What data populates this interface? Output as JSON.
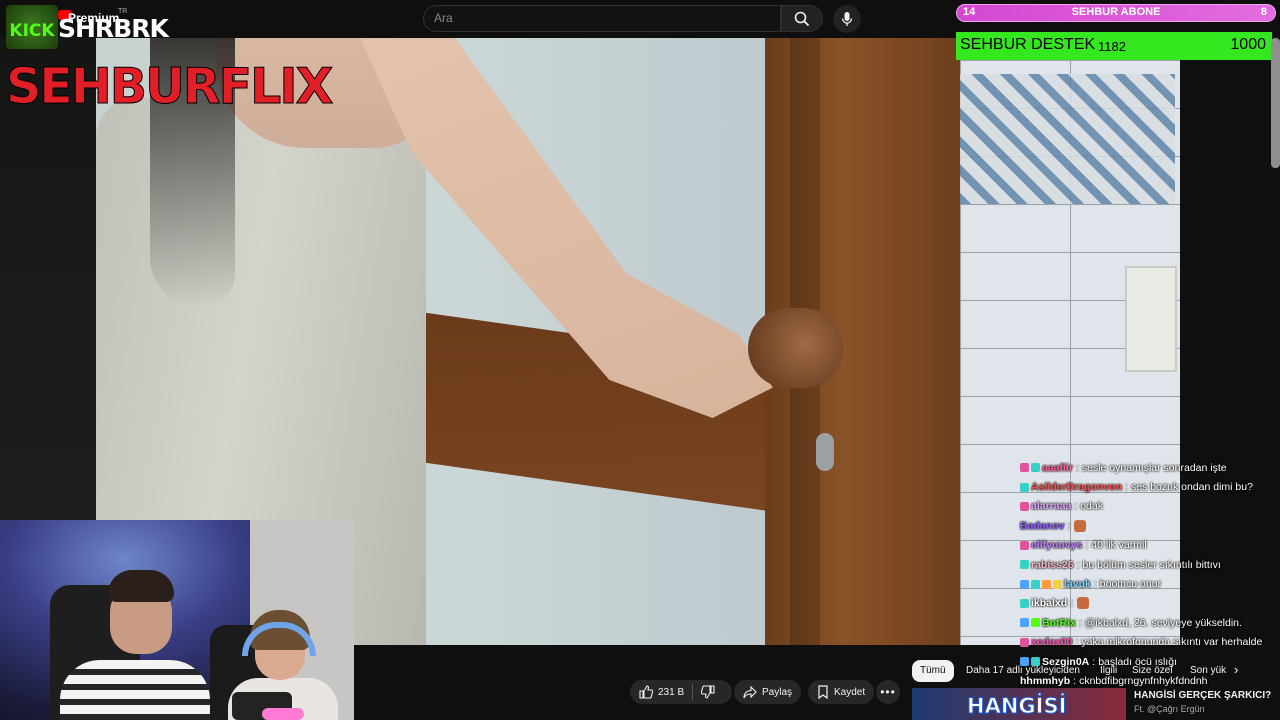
{
  "search": {
    "placeholder": "Ara"
  },
  "brand": {
    "youtube_premium": "Premium",
    "youtube_region": "TR",
    "kick": "KICK",
    "channel": "SHRBRK",
    "overlay_title": "SEHBURFLIX"
  },
  "goals": {
    "abone": {
      "label": "SEHBUR ABONE",
      "left": "14",
      "right": "8"
    },
    "destek": {
      "label": "SEHBUR DESTEK",
      "current": "1182",
      "target": "1000"
    }
  },
  "chat": [
    {
      "user": "aaafiir",
      "user_color": "#ff5f9e",
      "message": "sesle oynamışlar sonradan işte",
      "badges": [
        "#e0529c",
        "#35d0c6"
      ]
    },
    {
      "user": "AsilderDragonvon",
      "user_color": "#ff4f4f",
      "message": "ses bozuk ondan dimi bu?",
      "badges": [
        "#35d0c6"
      ]
    },
    {
      "user": "alarraaa",
      "user_color": "#e0a8ff",
      "message": "odak",
      "badges": [
        "#e0529c"
      ]
    },
    {
      "user": "Badanov",
      "user_color": "#8e5cff",
      "message": "",
      "badges": [],
      "emote": true
    },
    {
      "user": "elifyuuvys",
      "user_color": "#c27bff",
      "message": "40 lik varmil",
      "badges": [
        "#e0529c"
      ]
    },
    {
      "user": "rabiss26",
      "user_color": "#f0b8c8",
      "message": "bu bölüm sesler sıkıntılı bittıvı",
      "badges": [
        "#35d0c6"
      ]
    },
    {
      "user": "lavuk",
      "user_color": "#7fd3ff",
      "message": "boomcu onur",
      "badges": [
        "#4aa3ff",
        "#35d0c6",
        "#ff9a3d",
        "#f5d142"
      ]
    },
    {
      "user": "ikbalxd",
      "user_color": "#ffffff",
      "message": "",
      "badges": [
        "#35d0c6"
      ],
      "emote": true
    },
    {
      "user": "BotRix",
      "user_color": "#53fc18",
      "message": "@ikbalxd, 26. seviyeye yükseldin.",
      "badges": [
        "#4aa3ff",
        "#53fc18"
      ]
    },
    {
      "user": "xedax00",
      "user_color": "#ff4fb1",
      "message": "yaka mikrofonunda sıkıntı var herhalde",
      "badges": [
        "#e0529c"
      ]
    },
    {
      "user": "Sezgin0A",
      "user_color": "#ffffff",
      "message": "başladı öcü ıslığı",
      "badges": [
        "#4aa3ff",
        "#35d0c6"
      ]
    },
    {
      "user": "hhmmhyb",
      "user_color": "#ffffff",
      "message": "cknbdfibgrngynfnhykfdndnh",
      "badges": []
    }
  ],
  "actions": {
    "likes": "231 B",
    "share": "Paylaş",
    "save": "Kaydet"
  },
  "chips": [
    "Tümü",
    "Daha 17 adlı yükleyiciden",
    "İlgili",
    "Size özel",
    "Son yük"
  ],
  "suggestion": {
    "thumb_text": "HANGİSİ",
    "title": "HANGİSİ GERÇEK ŞARKICI?",
    "channel": "Ft. @Çağrı Ergün"
  }
}
